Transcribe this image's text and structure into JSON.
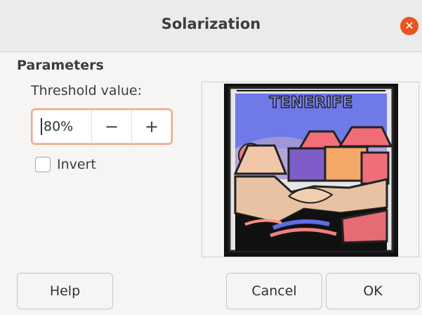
{
  "dialog": {
    "title": "Solarization",
    "close_icon": "close-icon",
    "accent_color": "#e95420"
  },
  "parameters": {
    "heading": "Parameters",
    "threshold_label": "Threshold value:",
    "threshold_value": "80%",
    "decrement": "−",
    "increment": "+",
    "invert_label": "Invert",
    "invert_checked": false
  },
  "preview": {
    "tile_text": "TENERIFE"
  },
  "buttons": {
    "help": "Help",
    "cancel": "Cancel",
    "ok": "OK"
  }
}
